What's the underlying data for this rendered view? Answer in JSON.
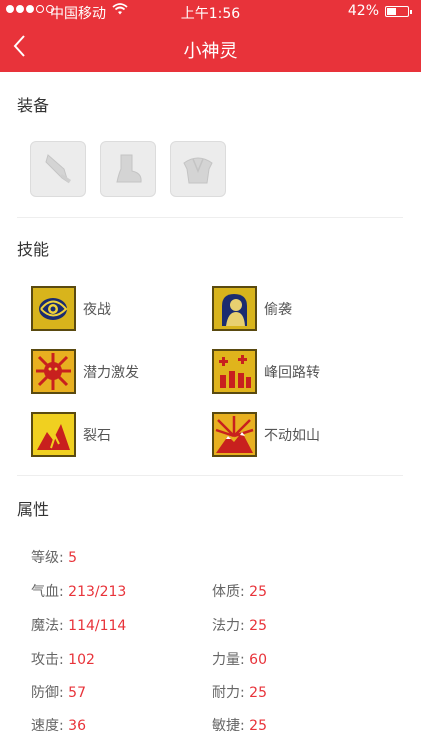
{
  "status": {
    "carrier": "中国移动",
    "time": "上午1:56",
    "battery": "42%"
  },
  "nav": {
    "title": "小神灵"
  },
  "sections": {
    "equipment": "装备",
    "skills": "技能",
    "attributes": "属性"
  },
  "equipment": [
    "sword-icon",
    "boots-icon",
    "armor-icon"
  ],
  "skills": [
    {
      "name": "夜战",
      "icon": "eye-swirl-icon"
    },
    {
      "name": "偷袭",
      "icon": "sneak-figure-icon"
    },
    {
      "name": "潜力激发",
      "icon": "burst-face-icon"
    },
    {
      "name": "峰回路转",
      "icon": "resurrection-icon"
    },
    {
      "name": "裂石",
      "icon": "rock-crack-icon"
    },
    {
      "name": "不动如山",
      "icon": "mountain-icon"
    }
  ],
  "attributes": {
    "level": {
      "label": "等级:",
      "value": "5"
    },
    "hp": {
      "label": "气血:",
      "value": "213/213"
    },
    "constitution": {
      "label": "体质:",
      "value": "25"
    },
    "mp": {
      "label": "魔法:",
      "value": "114/114"
    },
    "magic_power": {
      "label": "法力:",
      "value": "25"
    },
    "attack": {
      "label": "攻击:",
      "value": "102"
    },
    "strength": {
      "label": "力量:",
      "value": "60"
    },
    "defense": {
      "label": "防御:",
      "value": "57"
    },
    "endurance": {
      "label": "耐力:",
      "value": "25"
    },
    "speed": {
      "label": "速度:",
      "value": "36"
    },
    "agility": {
      "label": "敏捷:",
      "value": "25"
    }
  }
}
